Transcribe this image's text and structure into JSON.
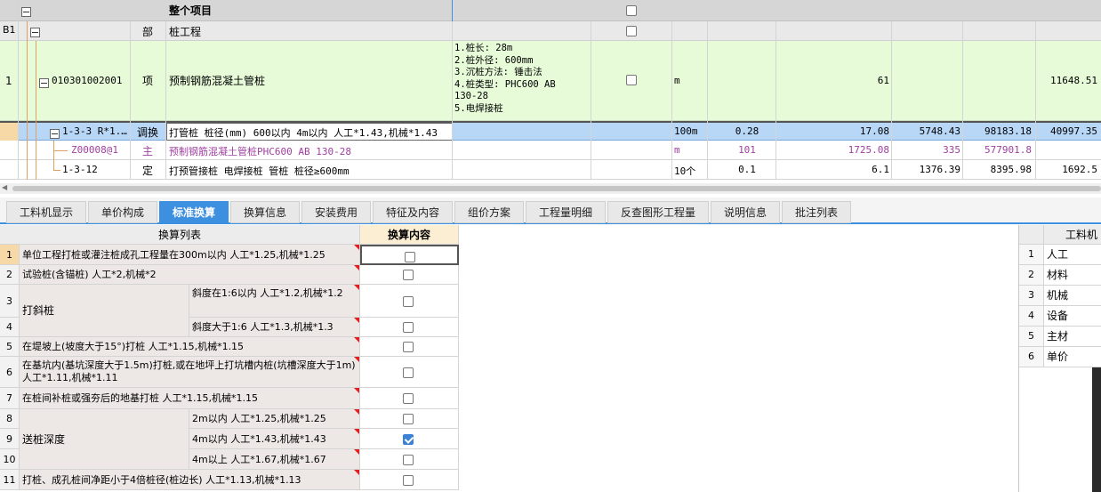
{
  "top": {
    "project_row": {
      "label": "整个项目"
    },
    "section_row": {
      "code": "B1",
      "type": "部",
      "name": "桩工程"
    },
    "item_row": {
      "num": "1",
      "code": "010301002001",
      "type": "项",
      "name": "预制钢筋混凝土管桩",
      "features": [
        "1.桩长: 28m",
        "2.桩外径: 600mm",
        "3.沉桩方法: 锤击法",
        "4.桩类型: PHC600 AB",
        "130-28",
        "5.电焊接桩"
      ],
      "unit": "m",
      "qty": "61",
      "total": "11648.51"
    },
    "sub_rows": [
      {
        "code": "1-3-3 R*1.…",
        "type": "调换",
        "name": "打管桩 桩径(mm) 600以内  4m以内 人工*1.43,机械*1.43",
        "unit": "100m",
        "qty": "0.28",
        "v1": "17.08",
        "v2": "5748.43",
        "v3": "98183.18",
        "v4": "40997.35"
      },
      {
        "code": "Z00008@1",
        "type": "主",
        "name": "预制钢筋混凝土管桩PHC600 AB 130-28",
        "unit": "m",
        "qty": "101",
        "v1": "1725.08",
        "v2": "335",
        "v3": "577901.8",
        "v4": ""
      },
      {
        "code": "1-3-12",
        "type": "定",
        "name": "打预管接桩 电焊接桩 管桩 桩径≥600mm",
        "unit": "10个",
        "qty": "0.1",
        "v1": "6.1",
        "v2": "1376.39",
        "v3": "8395.98",
        "v4": "1692.5"
      }
    ]
  },
  "tabs": [
    "工料机显示",
    "单价构成",
    "标准换算",
    "换算信息",
    "安装费用",
    "特征及内容",
    "组价方案",
    "工程量明细",
    "反查图形工程量",
    "说明信息",
    "批注列表"
  ],
  "conv": {
    "col_list": "换算列表",
    "col_content": "换算内容",
    "rows": [
      {
        "n": "1",
        "text": "单位工程打桩或灌注桩成孔工程量在300m以内 人工*1.25,机械*1.25",
        "checked": false
      },
      {
        "n": "2",
        "text": "试验桩(含锚桩) 人工*2,机械*2",
        "checked": false
      },
      {
        "n": "3",
        "group": "打斜桩",
        "text": "斜度在1:6以内 人工*1.2,机械*1.2",
        "checked": false
      },
      {
        "n": "4",
        "text": "斜度大于1:6 人工*1.3,机械*1.3",
        "checked": false
      },
      {
        "n": "5",
        "text": "在堤坡上(坡度大于15°)打桩 人工*1.15,机械*1.15",
        "checked": false
      },
      {
        "n": "6",
        "text": "在基坑内(基坑深度大于1.5m)打桩,或在地坪上打坑槽内桩(坑槽深度大于1m) 人工*1.11,机械*1.11",
        "checked": false
      },
      {
        "n": "7",
        "text": "在桩间补桩或强夯后的地基打桩 人工*1.15,机械*1.15",
        "checked": false
      },
      {
        "n": "8",
        "text": "2m以内 人工*1.25,机械*1.25",
        "checked": false
      },
      {
        "n": "9",
        "group": "送桩深度",
        "text": "4m以内 人工*1.43,机械*1.43",
        "checked": true
      },
      {
        "n": "10",
        "text": "4m以上 人工*1.67,机械*1.67",
        "checked": false
      },
      {
        "n": "11",
        "text": "打桩、成孔桩间净距小于4倍桩径(桩边长) 人工*1.13,机械*1.13",
        "checked": false
      }
    ]
  },
  "right_panel": {
    "header": "工料机",
    "rows": [
      {
        "n": "1",
        "t": "人工"
      },
      {
        "n": "2",
        "t": "材料"
      },
      {
        "n": "3",
        "t": "机械"
      },
      {
        "n": "4",
        "t": "设备"
      },
      {
        "n": "5",
        "t": "主材"
      },
      {
        "n": "6",
        "t": "单价"
      }
    ]
  },
  "colors": {
    "accent": "#3d8fe0",
    "green_row": "#e7fbd9",
    "selected_row": "#b8d7f7"
  }
}
